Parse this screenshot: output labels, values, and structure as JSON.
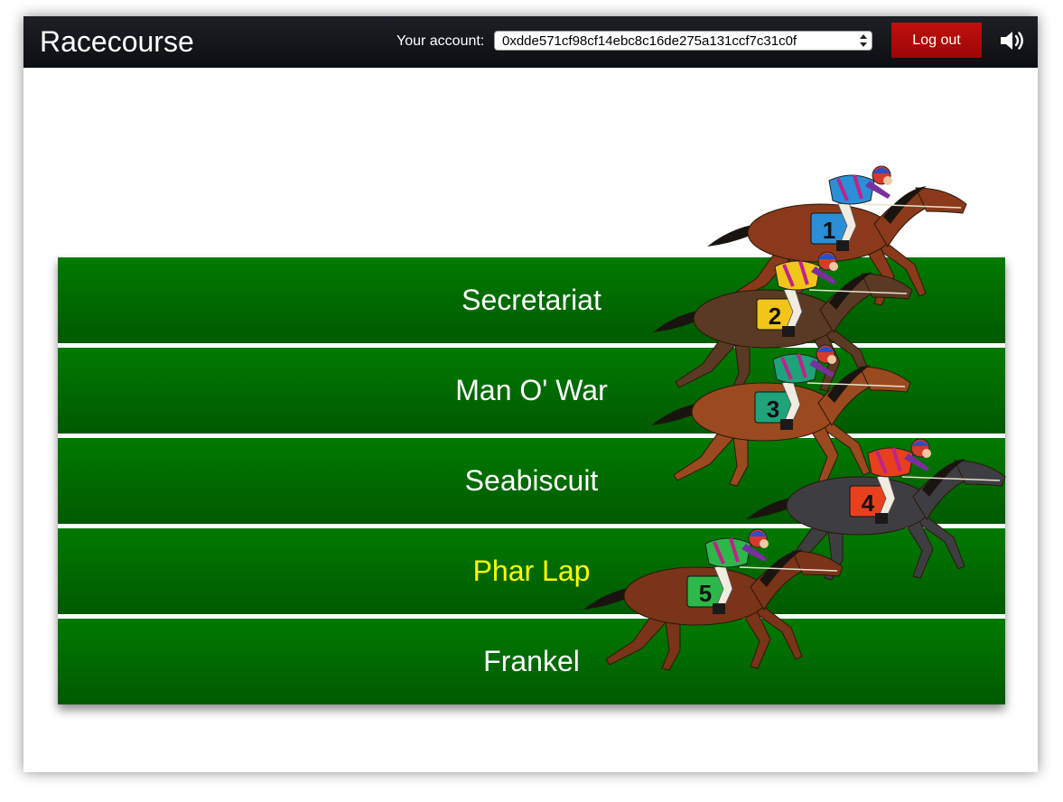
{
  "app": {
    "title": "Racecourse"
  },
  "header": {
    "account_label": "Your account:",
    "account_selected": "0xdde571cf98cf14ebc8c16de275a131ccf7c31c0f",
    "logout_label": "Log out",
    "sound_icon": "speaker-volume-icon"
  },
  "lanes": [
    {
      "name": "Secretariat",
      "highlighted": false
    },
    {
      "name": "Man O' War",
      "highlighted": false
    },
    {
      "name": "Seabiscuit",
      "highlighted": false
    },
    {
      "name": "Phar Lap",
      "highlighted": true
    },
    {
      "name": "Frankel",
      "highlighted": false
    }
  ],
  "horses": [
    {
      "number": "1",
      "saddle_color": "#2a8fd6",
      "coat_color": "#8a3a1a"
    },
    {
      "number": "2",
      "saddle_color": "#f2c51a",
      "coat_color": "#5a3a24"
    },
    {
      "number": "3",
      "saddle_color": "#1fa37a",
      "coat_color": "#9a4a1e"
    },
    {
      "number": "4",
      "saddle_color": "#e8401c",
      "coat_color": "#3e3e42"
    },
    {
      "number": "5",
      "saddle_color": "#2db84a",
      "coat_color": "#7a3418"
    }
  ],
  "colors": {
    "lane_green": "#007a00",
    "logout_red": "#b00c0c",
    "leader_yellow": "#ffff00",
    "topbar": "#12161b"
  }
}
